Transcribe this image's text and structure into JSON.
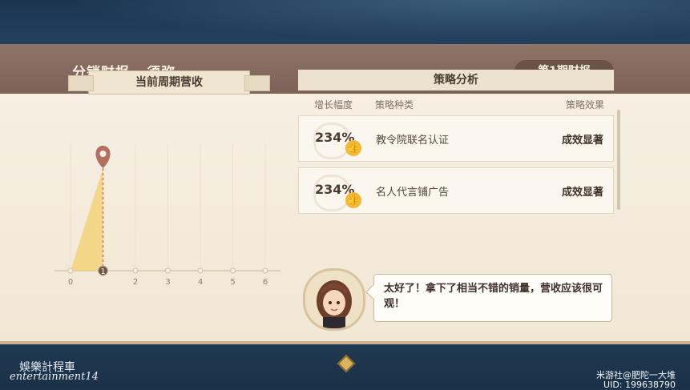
{
  "header": {
    "title": "分销财报 · 须弥",
    "period_badge": "第1期财报"
  },
  "chart": {
    "title": "当前周期营收"
  },
  "chart_data": {
    "type": "line",
    "title": "当前周期营收",
    "x": [
      0,
      1,
      2,
      3,
      4,
      5,
      6
    ],
    "current_period": 1,
    "values": [
      0,
      1
    ],
    "accent_color": "#f3d27a",
    "marker_color": "#b46f63"
  },
  "strategy": {
    "title": "策略分析",
    "columns": [
      "增长幅度",
      "策略种类",
      "策略效果"
    ],
    "rows": [
      {
        "growth": "234%",
        "type": "教令院联名认证",
        "effect": "成效显著"
      },
      {
        "growth": "234%",
        "type": "名人代言铺广告",
        "effect": "成效显著"
      }
    ]
  },
  "dialog": {
    "text": "太好了！拿下了相当不错的销量，营收应该很可观！"
  },
  "watermarks": {
    "left_line1": "娛樂計程車",
    "left_line2": "entertainment14",
    "right_line1": "米游社@肥陀一大堆",
    "right_line2": "UID: 199638790"
  }
}
